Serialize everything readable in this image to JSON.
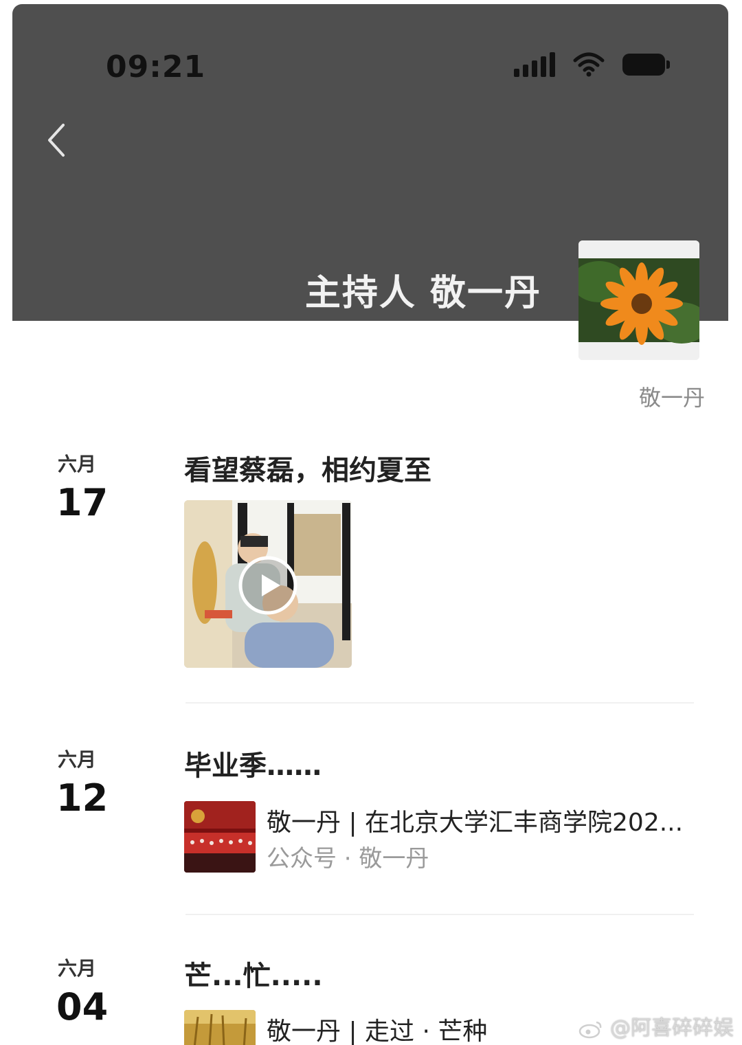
{
  "status_bar": {
    "time": "09:21"
  },
  "header": {
    "title": "主持人 敬一丹"
  },
  "profile": {
    "name": "敬一丹"
  },
  "entries": [
    {
      "month": "六月",
      "day": "17",
      "title": "看望蔡磊，相约夏至",
      "media": "video"
    },
    {
      "month": "六月",
      "day": "12",
      "title": "毕业季……",
      "article": {
        "title": "敬一丹 | 在北京大学汇丰商学院202...",
        "source": "公众号 · 敬一丹"
      }
    },
    {
      "month": "六月",
      "day": "04",
      "title": "芒...忙.....",
      "article": {
        "title": "敬一丹 | 走过 · 芒种"
      }
    }
  ],
  "watermark": "@阿喜碎碎娱",
  "icons": [
    "back-chevron-icon",
    "signal-icon",
    "wifi-icon",
    "battery-icon",
    "play-icon",
    "weibo-logo-icon"
  ]
}
